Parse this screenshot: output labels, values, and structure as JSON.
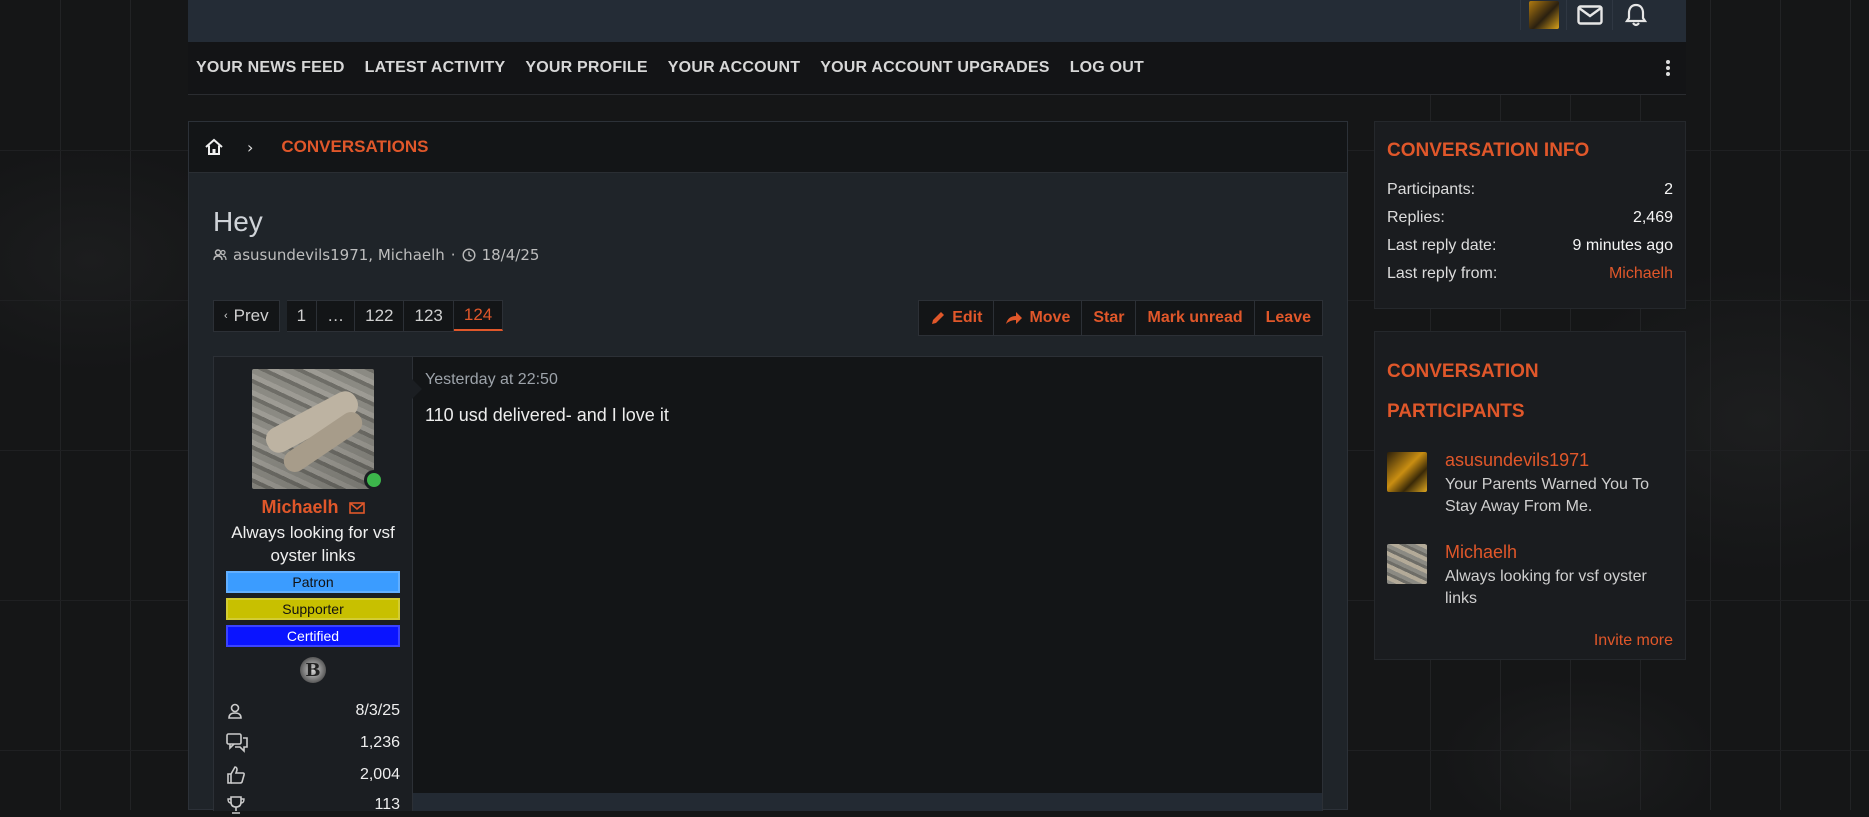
{
  "nav": {
    "items": [
      {
        "label": "YOUR NEWS FEED"
      },
      {
        "label": "LATEST ACTIVITY"
      },
      {
        "label": "YOUR PROFILE"
      },
      {
        "label": "YOUR ACCOUNT"
      },
      {
        "label": "YOUR ACCOUNT UPGRADES"
      },
      {
        "label": "LOG OUT"
      }
    ]
  },
  "breadcrumb": {
    "current": "CONVERSATIONS"
  },
  "conversation": {
    "title": "Hey",
    "participants_text": "asusundevils1971, Michaelh",
    "date": "18/4/25"
  },
  "pager": {
    "prev_label": "Prev",
    "pages": [
      "1",
      "…",
      "122",
      "123",
      "124"
    ],
    "current": "124"
  },
  "actions": {
    "edit": "Edit",
    "move": "Move",
    "star": "Star",
    "mark_unread": "Mark unread",
    "leave": "Leave"
  },
  "post": {
    "date": "Yesterday at 22:50",
    "message": "110 usd delivered- and I love it",
    "author": {
      "name": "Michaelh",
      "title": "Always looking for vsf oyster links",
      "badges": [
        {
          "label": "Patron",
          "color": "#3b9cff",
          "text_color": "#111111"
        },
        {
          "label": "Supporter",
          "color": "#c8c000",
          "text_color": "#111111"
        },
        {
          "label": "Certified",
          "color": "#0a14ff",
          "text_color": "#ffffff"
        }
      ],
      "logo_letter": "B",
      "stats": {
        "joined": "8/3/25",
        "messages": "1,236",
        "reactions": "2,004",
        "points": "113"
      }
    }
  },
  "sidebar": {
    "info": {
      "heading": "CONVERSATION INFO",
      "participants_label": "Participants:",
      "participants_value": "2",
      "replies_label": "Replies:",
      "replies_value": "2,469",
      "last_reply_date_label": "Last reply date:",
      "last_reply_date_value": "9 minutes ago",
      "last_reply_from_label": "Last reply from:",
      "last_reply_from_value": "Michaelh"
    },
    "participants": {
      "heading_line1": "CONVERSATION",
      "heading_line2": "PARTICIPANTS",
      "list": [
        {
          "name": "asusundevils1971",
          "title": "Your Parents Warned You To Stay Away From Me."
        },
        {
          "name": "Michaelh",
          "title": "Always looking for vsf oyster links"
        }
      ],
      "invite_label": "Invite more"
    }
  },
  "colors": {
    "accent": "#e0572a",
    "online": "#3cb64b"
  }
}
